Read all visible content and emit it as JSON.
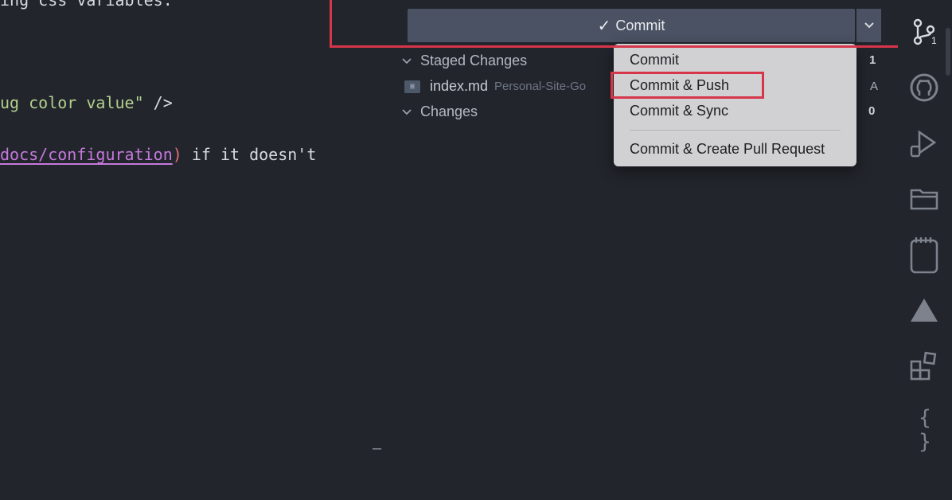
{
  "editor": {
    "lines": [
      {
        "text": "ing css variables."
      },
      {
        "pre": "ug color value\"",
        "post": " />"
      },
      {
        "link": "docs/configuration",
        "paren": ")",
        "post": " if it doesn't"
      }
    ]
  },
  "scm": {
    "commit_button": {
      "label": "Commit"
    },
    "staged": {
      "label": "Staged Changes",
      "count": "1"
    },
    "file": {
      "name": "index.md",
      "path": "Personal-Site-Go",
      "status": "A",
      "icon": "md-file-icon"
    },
    "changes": {
      "label": "Changes",
      "count": "0"
    },
    "panel_marker": "–"
  },
  "menu": {
    "items": [
      "Commit",
      "Commit & Push",
      "Commit & Sync",
      "Commit & Create Pull Request"
    ]
  },
  "activity_bar": {
    "source_control_badge": "1",
    "icons": [
      "source-control-icon",
      "github-icon",
      "run-debug-icon",
      "folder-icon",
      "notebook-icon",
      "triangle-icon",
      "extensions-icon",
      "braces-icon"
    ]
  },
  "colors": {
    "highlight": "#d7364a",
    "background": "#22252c",
    "button": "#4a5263",
    "menu": "#d1d1d3"
  }
}
